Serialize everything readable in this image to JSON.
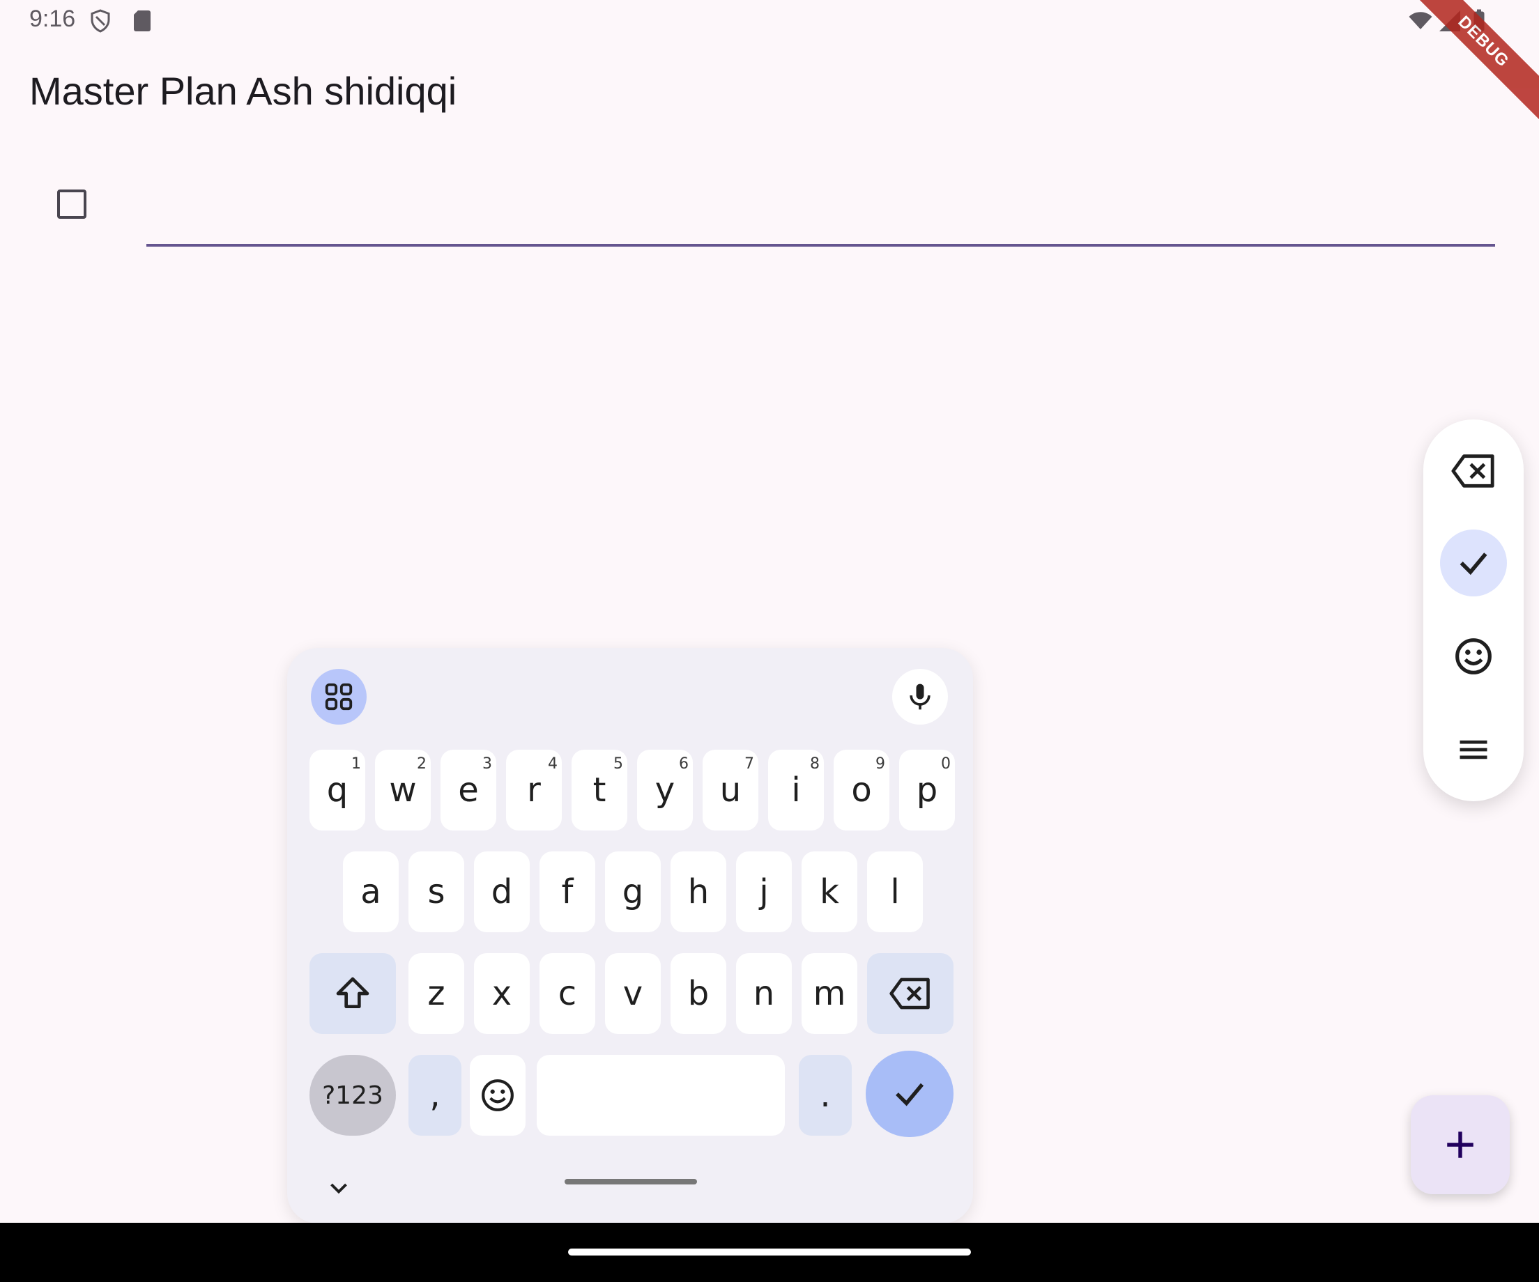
{
  "status_bar": {
    "time": "9:16"
  },
  "debug_banner": "DEBUG",
  "app": {
    "title": "Master Plan Ash shidiqqi"
  },
  "task": {
    "value": "",
    "checked": false
  },
  "floating_toolbar": {
    "items": [
      "backspace-icon",
      "check-icon",
      "emoji-icon",
      "menu-icon"
    ]
  },
  "keyboard": {
    "row1": [
      {
        "key": "q",
        "hint": "1"
      },
      {
        "key": "w",
        "hint": "2"
      },
      {
        "key": "e",
        "hint": "3"
      },
      {
        "key": "r",
        "hint": "4"
      },
      {
        "key": "t",
        "hint": "5"
      },
      {
        "key": "y",
        "hint": "6"
      },
      {
        "key": "u",
        "hint": "7"
      },
      {
        "key": "i",
        "hint": "8"
      },
      {
        "key": "o",
        "hint": "9"
      },
      {
        "key": "p",
        "hint": "0"
      }
    ],
    "row2": [
      "a",
      "s",
      "d",
      "f",
      "g",
      "h",
      "j",
      "k",
      "l"
    ],
    "row3": [
      "z",
      "x",
      "c",
      "v",
      "b",
      "n",
      "m"
    ],
    "symbols_label": "?123",
    "comma": ",",
    "period": "."
  },
  "fab": {
    "icon": "plus-icon"
  }
}
